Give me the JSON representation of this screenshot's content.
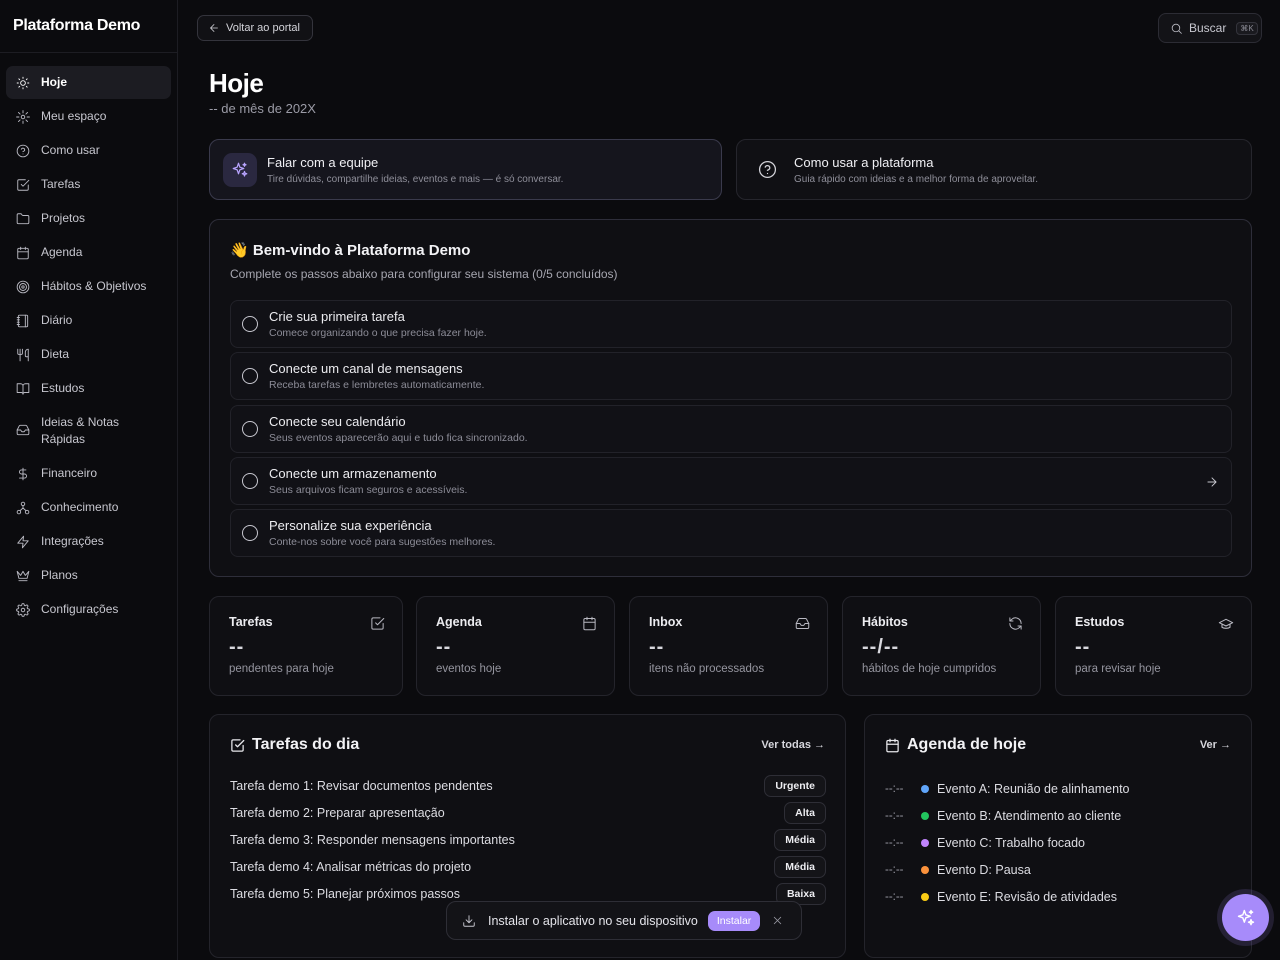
{
  "app": {
    "brand": "Plataforma Demo"
  },
  "colors": {
    "accent": "#a78bfa",
    "background": "#0b0b0e"
  },
  "sidebar": {
    "items": [
      {
        "label": "Hoje",
        "icon": "sun-icon",
        "active": true
      },
      {
        "label": "Meu espaço",
        "icon": "gear-icon"
      },
      {
        "label": "Como usar",
        "icon": "help-circle-icon"
      },
      {
        "label": "Tarefas",
        "icon": "checkbox-icon"
      },
      {
        "label": "Projetos",
        "icon": "folder-icon"
      },
      {
        "label": "Agenda",
        "icon": "calendar-icon"
      },
      {
        "label": "Hábitos & Objetivos",
        "icon": "target-icon"
      },
      {
        "label": "Diário",
        "icon": "notebook-icon"
      },
      {
        "label": "Dieta",
        "icon": "utensils-icon"
      },
      {
        "label": "Estudos",
        "icon": "book-open-icon"
      },
      {
        "label": "Ideias & Notas Rápidas",
        "icon": "inbox-icon"
      },
      {
        "label": "Financeiro",
        "icon": "dollar-icon"
      },
      {
        "label": "Conhecimento",
        "icon": "network-icon"
      },
      {
        "label": "Integrações",
        "icon": "bolt-icon"
      },
      {
        "label": "Planos",
        "icon": "crown-icon"
      },
      {
        "label": "Configurações",
        "icon": "settings-icon"
      }
    ]
  },
  "topbar": {
    "back_label": "Voltar ao portal",
    "search_label": "Buscar",
    "search_shortcut": "⌘K"
  },
  "header": {
    "title": "Hoje",
    "date": "-- de mês de 202X"
  },
  "quick_cards": [
    {
      "title": "Falar com a equipe",
      "subtitle": "Tire dúvidas, compartilhe ideias, eventos e mais — é só conversar."
    },
    {
      "title": "Como usar a plataforma",
      "subtitle": "Guia rápido com ideias e a melhor forma de aproveitar."
    }
  ],
  "welcome": {
    "emoji": "👋",
    "title": "Bem-vindo à Plataforma Demo",
    "subtitle": "Complete os passos abaixo para configurar seu sistema (0/5 concluídos)",
    "steps": [
      {
        "title": "Crie sua primeira tarefa",
        "subtitle": "Comece organizando o que precisa fazer hoje."
      },
      {
        "title": "Conecte um canal de mensagens",
        "subtitle": "Receba tarefas e lembretes automaticamente."
      },
      {
        "title": "Conecte seu calendário",
        "subtitle": "Seus eventos aparecerão aqui e tudo fica sincronizado."
      },
      {
        "title": "Conecte um armazenamento",
        "subtitle": "Seus arquivos ficam seguros e acessíveis."
      },
      {
        "title": "Personalize sua experiência",
        "subtitle": "Conte-nos sobre você para sugestões melhores."
      }
    ]
  },
  "stats": [
    {
      "title": "Tarefas",
      "value": "--",
      "label": "pendentes para hoje",
      "icon": "checkbox-icon"
    },
    {
      "title": "Agenda",
      "value": "--",
      "label": "eventos hoje",
      "icon": "calendar-icon"
    },
    {
      "title": "Inbox",
      "value": "--",
      "label": "itens não processados",
      "icon": "inbox-icon"
    },
    {
      "title": "Hábitos",
      "value": "--/--",
      "label": "hábitos de hoje cumpridos",
      "icon": "refresh-icon"
    },
    {
      "title": "Estudos",
      "value": "--",
      "label": "para revisar hoje",
      "icon": "graduation-cap-icon"
    }
  ],
  "tasks_panel": {
    "title": "Tarefas do dia",
    "link": "Ver todas →",
    "tasks": [
      {
        "name": "Tarefa demo 1: Revisar documentos pendentes",
        "priority": "Urgente"
      },
      {
        "name": "Tarefa demo 2: Preparar apresentação",
        "priority": "Alta"
      },
      {
        "name": "Tarefa demo 3: Responder mensagens importantes",
        "priority": "Média"
      },
      {
        "name": "Tarefa demo 4: Analisar métricas do projeto",
        "priority": "Média"
      },
      {
        "name": "Tarefa demo 5: Planejar próximos passos",
        "priority": "Baixa"
      }
    ]
  },
  "agenda_panel": {
    "title": "Agenda de hoje",
    "link": "Ver →",
    "events": [
      {
        "time": "--:--",
        "name": "Evento A: Reunião de alinhamento",
        "color": "#60a5fa"
      },
      {
        "time": "--:--",
        "name": "Evento B: Atendimento ao cliente",
        "color": "#22c55e"
      },
      {
        "time": "--:--",
        "name": "Evento C: Trabalho focado",
        "color": "#c084fc"
      },
      {
        "time": "--:--",
        "name": "Evento D: Pausa",
        "color": "#fb923c"
      },
      {
        "time": "--:--",
        "name": "Evento E: Revisão de atividades",
        "color": "#facc15"
      }
    ]
  },
  "install_toast": {
    "message": "Instalar o aplicativo no seu dispositivo",
    "button": "Instalar"
  }
}
